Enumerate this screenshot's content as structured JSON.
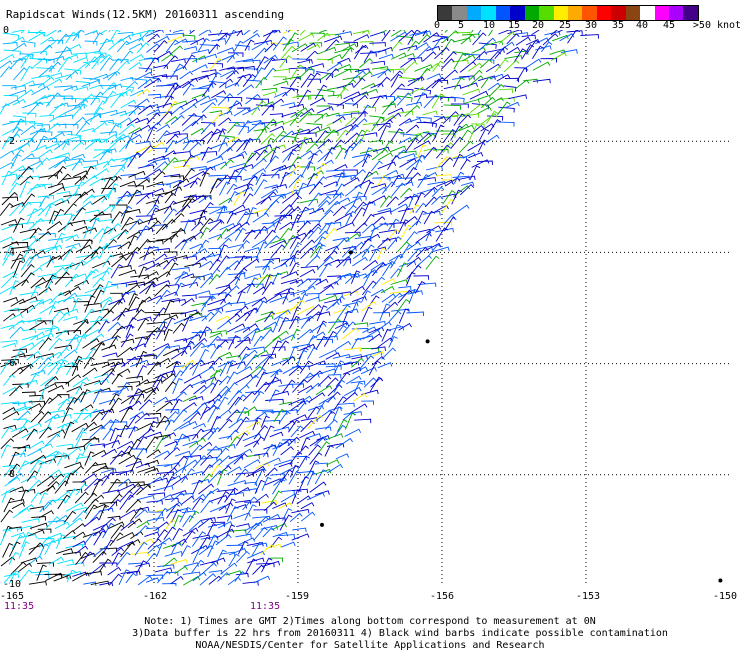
{
  "title": "Rapidscat Winds(12.5KM) 20160311 ascending",
  "legend": {
    "colors": [
      "#3a3a3a",
      "#8a8a8a",
      "#00aaff",
      "#00e0ff",
      "#0055ff",
      "#0000cc",
      "#00aa00",
      "#55dd00",
      "#ffee00",
      "#ffaa00",
      "#ff5500",
      "#ff0000",
      "#cc0000",
      "#8b4513",
      "#ffffff",
      "#ff00ff",
      "#aa00ff",
      "#440088"
    ],
    "labels": [
      "0",
      "5",
      "10",
      "15",
      "20",
      "25",
      "30",
      "35",
      "40",
      "45",
      ">50 knots"
    ]
  },
  "x_ticks": [
    "-165",
    "-162",
    "-159",
    "-156",
    "-153",
    "-150"
  ],
  "y_ticks": [
    "0",
    "-2",
    "-4",
    "-6",
    "-8",
    "-10"
  ],
  "times": [
    "11:35",
    "11:35"
  ],
  "notes": [
    "Note: 1) Times are GMT 2)Times along bottom correspond to measurement at 0N",
    "3)Data buffer is 22 hrs from 20160311 4) Black wind barbs indicate possible contamination",
    "NOAA/NESDIS/Center for Satellite Applications and Research"
  ],
  "map": {
    "lon_range": [
      -165,
      -150
    ],
    "lat_range": [
      -10,
      0
    ],
    "swath_edge": [
      [
        -153.0,
        0.0
      ],
      [
        -154.5,
        -1.2
      ],
      [
        -156.0,
        -3.8
      ],
      [
        -157.5,
        -6.6
      ],
      [
        -159.0,
        -9.0
      ],
      [
        -159.8,
        -10.0
      ]
    ],
    "wind_barb_colors": [
      "#000000",
      "#00aaff",
      "#00e0ff",
      "#0055ff",
      "#0000cc",
      "#00aa00",
      "#55dd00",
      "#ffee00"
    ]
  }
}
